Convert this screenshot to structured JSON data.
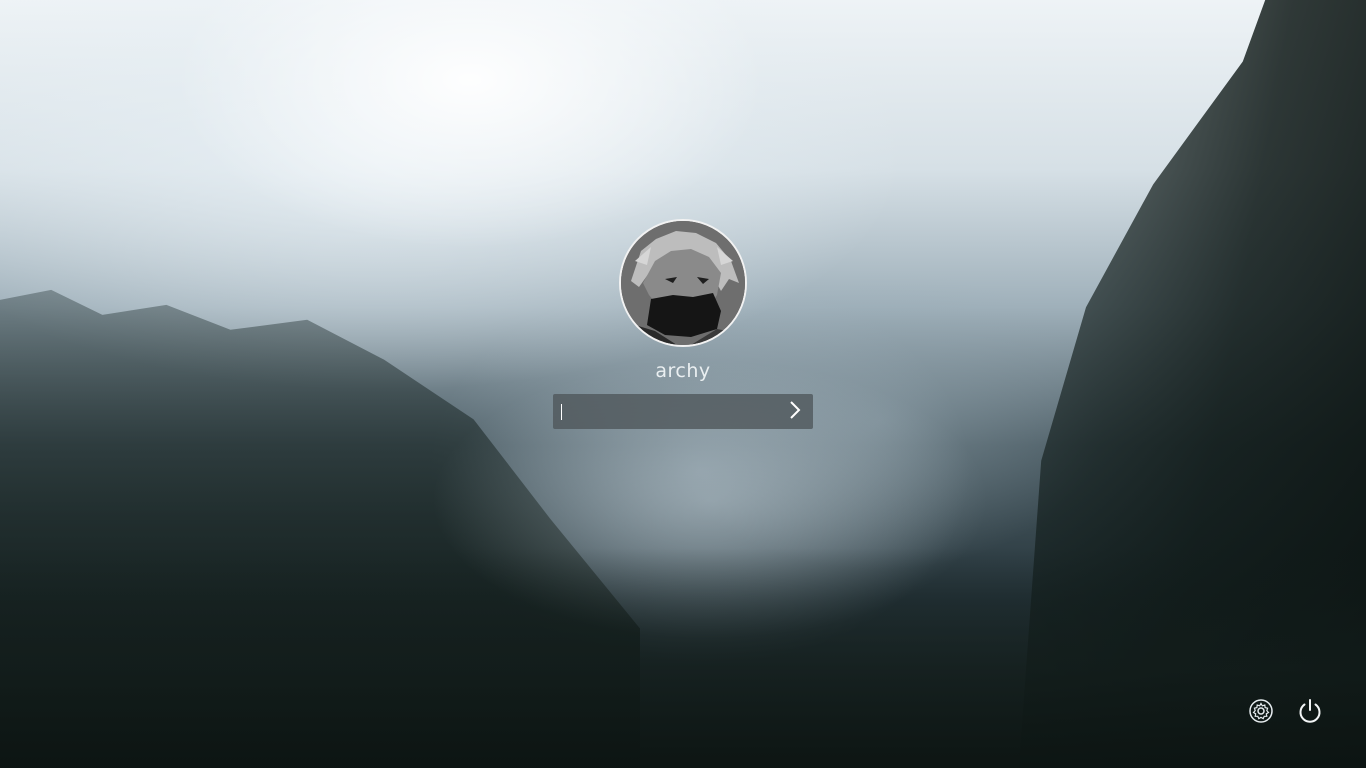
{
  "background": {
    "description_colors": {
      "sky": "#eef3f6",
      "mist": "#9fb0ba",
      "forest": "#17221f"
    }
  },
  "user": {
    "name": "archy",
    "avatar_icon": "user-avatar-image"
  },
  "password": {
    "value": "",
    "placeholder": "",
    "submit_icon": "chevron-right-icon"
  },
  "system": {
    "settings_icon": "gear-icon",
    "power_icon": "power-icon"
  }
}
